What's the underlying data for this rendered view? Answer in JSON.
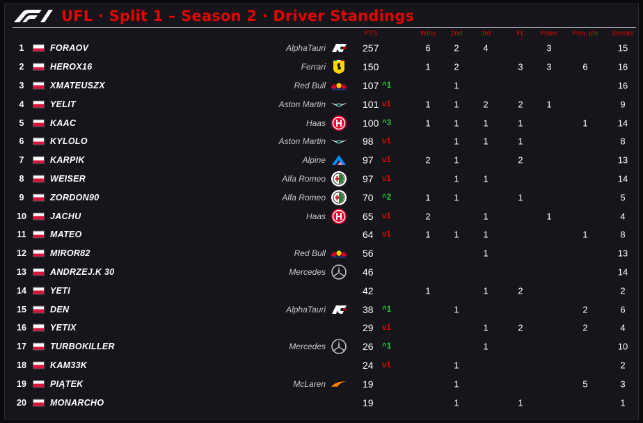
{
  "header": {
    "title": "UFL · Split 1 – Season 2 · Driver Standings",
    "logo_name": "f1-logo",
    "accent": "#e10600"
  },
  "columns": {
    "pts": "PTS",
    "wins": "Wins",
    "second": "2nd",
    "third": "3rd",
    "fl": "FL",
    "poles": "Poles",
    "pen": "Pen. pts",
    "events": "Events"
  },
  "colors": {
    "up": "#27c93f",
    "down": "#e10600",
    "flag_white": "#ffffff",
    "flag_red": "#dc143c"
  },
  "drivers": [
    {
      "pos": "1",
      "name": "FORAOV",
      "team": "AlphaTauri",
      "logo": "alphatauri",
      "pts": "257",
      "chg": "",
      "dir": "",
      "wins": "6",
      "second": "2",
      "third": "4",
      "fl": "",
      "poles": "3",
      "pen": "",
      "events": "15"
    },
    {
      "pos": "2",
      "name": "HEROX16",
      "team": "Ferrari",
      "logo": "ferrari",
      "pts": "150",
      "chg": "",
      "dir": "",
      "wins": "1",
      "second": "2",
      "third": "",
      "fl": "3",
      "poles": "3",
      "pen": "6",
      "events": "16"
    },
    {
      "pos": "3",
      "name": "XMATEUSZX",
      "team": "Red Bull",
      "logo": "redbull",
      "pts": "107",
      "chg": "^1",
      "dir": "up",
      "wins": "",
      "second": "1",
      "third": "",
      "fl": "",
      "poles": "",
      "pen": "",
      "events": "16"
    },
    {
      "pos": "4",
      "name": "YELIT",
      "team": "Aston Martin",
      "logo": "astonmartin",
      "pts": "101",
      "chg": "v1",
      "dir": "down",
      "wins": "1",
      "second": "1",
      "third": "2",
      "fl": "2",
      "poles": "1",
      "pen": "",
      "events": "9"
    },
    {
      "pos": "5",
      "name": "KAAC",
      "team": "Haas",
      "logo": "haas",
      "pts": "100",
      "chg": "^3",
      "dir": "up",
      "wins": "1",
      "second": "1",
      "third": "1",
      "fl": "1",
      "poles": "",
      "pen": "1",
      "events": "14"
    },
    {
      "pos": "6",
      "name": "KYLOLO",
      "team": "Aston Martin",
      "logo": "astonmartin",
      "pts": "98",
      "chg": "v1",
      "dir": "down",
      "wins": "",
      "second": "1",
      "third": "1",
      "fl": "1",
      "poles": "",
      "pen": "",
      "events": "8"
    },
    {
      "pos": "7",
      "name": "KARPIK",
      "team": "Alpine",
      "logo": "alpine",
      "pts": "97",
      "chg": "v1",
      "dir": "down",
      "wins": "2",
      "second": "1",
      "third": "",
      "fl": "2",
      "poles": "",
      "pen": "",
      "events": "13"
    },
    {
      "pos": "8",
      "name": "WEISER",
      "team": "Alfa Romeo",
      "logo": "alfaromeo",
      "pts": "97",
      "chg": "v1",
      "dir": "down",
      "wins": "",
      "second": "1",
      "third": "1",
      "fl": "",
      "poles": "",
      "pen": "",
      "events": "14"
    },
    {
      "pos": "9",
      "name": "ZORDON90",
      "team": "Alfa Romeo",
      "logo": "alfaromeo",
      "pts": "70",
      "chg": "^2",
      "dir": "up",
      "wins": "1",
      "second": "1",
      "third": "",
      "fl": "1",
      "poles": "",
      "pen": "",
      "events": "5"
    },
    {
      "pos": "10",
      "name": "JACHU",
      "team": "Haas",
      "logo": "haas",
      "pts": "65",
      "chg": "v1",
      "dir": "down",
      "wins": "2",
      "second": "",
      "third": "1",
      "fl": "",
      "poles": "1",
      "pen": "",
      "events": "4"
    },
    {
      "pos": "11",
      "name": "MATEO",
      "team": "",
      "logo": "",
      "pts": "64",
      "chg": "v1",
      "dir": "down",
      "wins": "1",
      "second": "1",
      "third": "1",
      "fl": "",
      "poles": "",
      "pen": "1",
      "events": "8"
    },
    {
      "pos": "12",
      "name": "MIROR82",
      "team": "Red Bull",
      "logo": "redbull",
      "pts": "56",
      "chg": "",
      "dir": "",
      "wins": "",
      "second": "",
      "third": "1",
      "fl": "",
      "poles": "",
      "pen": "",
      "events": "13"
    },
    {
      "pos": "13",
      "name": "ANDRZEJ.K 30",
      "team": "Mercedes",
      "logo": "mercedes",
      "pts": "46",
      "chg": "",
      "dir": "",
      "wins": "",
      "second": "",
      "third": "",
      "fl": "",
      "poles": "",
      "pen": "",
      "events": "14"
    },
    {
      "pos": "14",
      "name": "YETI",
      "team": "",
      "logo": "",
      "pts": "42",
      "chg": "",
      "dir": "",
      "wins": "1",
      "second": "",
      "third": "1",
      "fl": "2",
      "poles": "",
      "pen": "",
      "events": "2"
    },
    {
      "pos": "15",
      "name": "DEN",
      "team": "AlphaTauri",
      "logo": "alphatauri",
      "pts": "38",
      "chg": "^1",
      "dir": "up",
      "wins": "",
      "second": "1",
      "third": "",
      "fl": "",
      "poles": "",
      "pen": "2",
      "events": "6"
    },
    {
      "pos": "16",
      "name": "YETIX",
      "team": "",
      "logo": "",
      "pts": "29",
      "chg": "v1",
      "dir": "down",
      "wins": "",
      "second": "",
      "third": "1",
      "fl": "2",
      "poles": "",
      "pen": "2",
      "events": "4"
    },
    {
      "pos": "17",
      "name": "TURBOKILLER",
      "team": "Mercedes",
      "logo": "mercedes",
      "pts": "26",
      "chg": "^1",
      "dir": "up",
      "wins": "",
      "second": "",
      "third": "1",
      "fl": "",
      "poles": "",
      "pen": "",
      "events": "10"
    },
    {
      "pos": "18",
      "name": "KAM33K",
      "team": "",
      "logo": "",
      "pts": "24",
      "chg": "v1",
      "dir": "down",
      "wins": "",
      "second": "1",
      "third": "",
      "fl": "",
      "poles": "",
      "pen": "",
      "events": "2"
    },
    {
      "pos": "19",
      "name": "PIĄTEK",
      "team": "McLaren",
      "logo": "mclaren",
      "pts": "19",
      "chg": "",
      "dir": "",
      "wins": "",
      "second": "1",
      "third": "",
      "fl": "",
      "poles": "",
      "pen": "5",
      "events": "3"
    },
    {
      "pos": "20",
      "name": "MONARCHO",
      "team": "",
      "logo": "",
      "pts": "19",
      "chg": "",
      "dir": "",
      "wins": "",
      "second": "1",
      "third": "",
      "fl": "1",
      "poles": "",
      "pen": "",
      "events": "1"
    }
  ]
}
